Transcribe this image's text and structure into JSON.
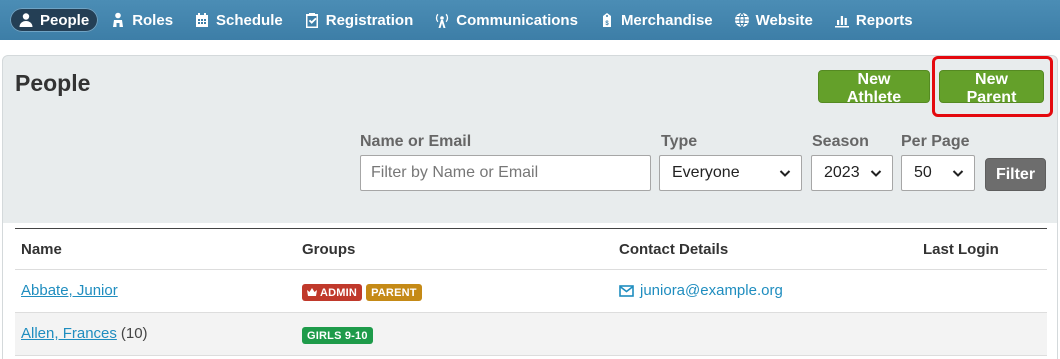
{
  "nav": {
    "items": [
      {
        "label": "People",
        "icon": "users-icon",
        "active": true
      },
      {
        "label": "Roles",
        "icon": "roles-icon"
      },
      {
        "label": "Schedule",
        "icon": "calendar-icon"
      },
      {
        "label": "Registration",
        "icon": "clipboard-check-icon"
      },
      {
        "label": "Communications",
        "icon": "broadcast-tower-icon"
      },
      {
        "label": "Merchandise",
        "icon": "price-tag-icon"
      },
      {
        "label": "Website",
        "icon": "globe-icon"
      },
      {
        "label": "Reports",
        "icon": "bar-chart-icon"
      }
    ]
  },
  "page": {
    "title": "People",
    "buttons": {
      "new_athlete": "New Athlete",
      "new_parent": "New Parent"
    }
  },
  "filters": {
    "name_label": "Name or Email",
    "name_placeholder": "Filter by Name or Email",
    "type_label": "Type",
    "type_value": "Everyone",
    "season_label": "Season",
    "season_value": "2023",
    "per_page_label": "Per Page",
    "per_page_value": "50",
    "filter_button": "Filter"
  },
  "table": {
    "headers": {
      "name": "Name",
      "groups": "Groups",
      "contact": "Contact Details",
      "last_login": "Last Login"
    },
    "rows": [
      {
        "name": "Abbate, Junior",
        "extra": "",
        "badges": [
          {
            "label": "ADMIN",
            "color": "#c0392b",
            "icon": "crown-icon"
          },
          {
            "label": "PARENT",
            "color": "#c58a16"
          }
        ],
        "email": "juniora@example.org",
        "last_login": ""
      },
      {
        "name": "Allen, Frances",
        "extra": "(10)",
        "badges": [
          {
            "label": "GIRLS 9-10",
            "color": "#1e9b4a"
          }
        ],
        "email": "",
        "last_login": ""
      }
    ]
  },
  "colors": {
    "nav_bg": "#3d7ea7",
    "accent_green": "#64a02a",
    "link": "#1f8dbf",
    "highlight": "#e4090e"
  }
}
